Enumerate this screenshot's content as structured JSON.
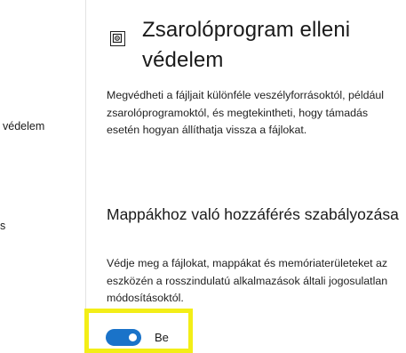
{
  "sidebar": {
    "items": [
      {
        "label": "védelem"
      },
      {
        "label": "s"
      }
    ]
  },
  "header": {
    "icon": "ransomware-shield-icon",
    "title": "Zsarolóprogram elleni védelem"
  },
  "intro": {
    "text": "Megvédheti a fájljait különféle veszélyforrásoktól, például zsarolóprogramoktól, és megtekintheti, hogy támadás esetén hogyan állíthatja vissza a fájlokat."
  },
  "section": {
    "title": "Mappákhoz való hozzáférés szabályozása",
    "description": "Védje meg a fájlokat, mappákat és memóriaterületeket az eszközén a rosszindulatú alkalmazások általi jogosulatlan módosításoktól.",
    "toggle": {
      "state": "on",
      "label": "Be"
    }
  },
  "colors": {
    "toggle_on": "#1a73c9",
    "highlight": "#f3ee17",
    "divider": "#e3e3e3"
  }
}
